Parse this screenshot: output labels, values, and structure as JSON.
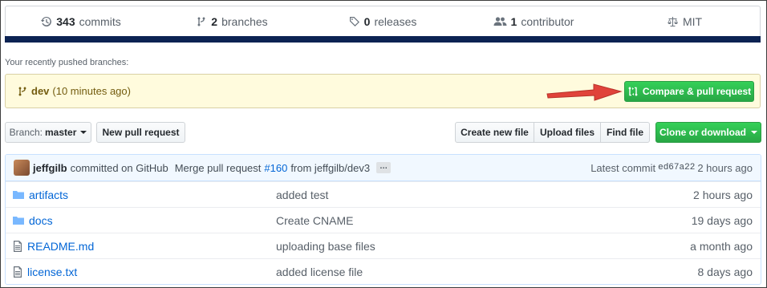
{
  "summary": {
    "commits": {
      "count": "343",
      "label": "commits",
      "icon": "history-icon"
    },
    "branches": {
      "count": "2",
      "label": "branches",
      "icon": "git-branch-icon"
    },
    "releases": {
      "count": "0",
      "label": "releases",
      "icon": "tag-icon"
    },
    "contributors": {
      "count": "1",
      "label": "contributor",
      "icon": "people-icon"
    },
    "license": {
      "label": "MIT",
      "icon": "law-icon"
    },
    "language_bar_color": "#0c2353"
  },
  "recent": {
    "label": "Your recently pushed branches:",
    "branch": "dev",
    "time": "(10 minutes ago)",
    "compare_label": "Compare & pull request"
  },
  "toolbar": {
    "branch_prefix": "Branch:",
    "branch_name": "master",
    "new_pr": "New pull request",
    "create_file": "Create new file",
    "upload_files": "Upload files",
    "find_file": "Find file",
    "clone": "Clone or download"
  },
  "commit": {
    "author": "jeffgilb",
    "committed_on": "committed on GitHub",
    "message": "Merge pull request",
    "pr_number": "#160",
    "pr_from": "from jeffgilb/dev3",
    "ellipsis": "…",
    "latest_label": "Latest commit",
    "sha": "ed67a22",
    "time": "2 hours ago"
  },
  "files": [
    {
      "name": "artifacts",
      "type": "folder",
      "message": "added test",
      "age": "2 hours ago"
    },
    {
      "name": "docs",
      "type": "folder",
      "message": "Create CNAME",
      "age": "19 days ago"
    },
    {
      "name": "README.md",
      "type": "file",
      "message": "uploading base files",
      "age": "a month ago"
    },
    {
      "name": "license.txt",
      "type": "file",
      "message": "added license file",
      "age": "8 days ago"
    }
  ],
  "colors": {
    "accent_green": "#28a745",
    "link_blue": "#0366d6",
    "banner_yellow": "#fffbdd",
    "annotation_arrow": "#e0433a"
  }
}
